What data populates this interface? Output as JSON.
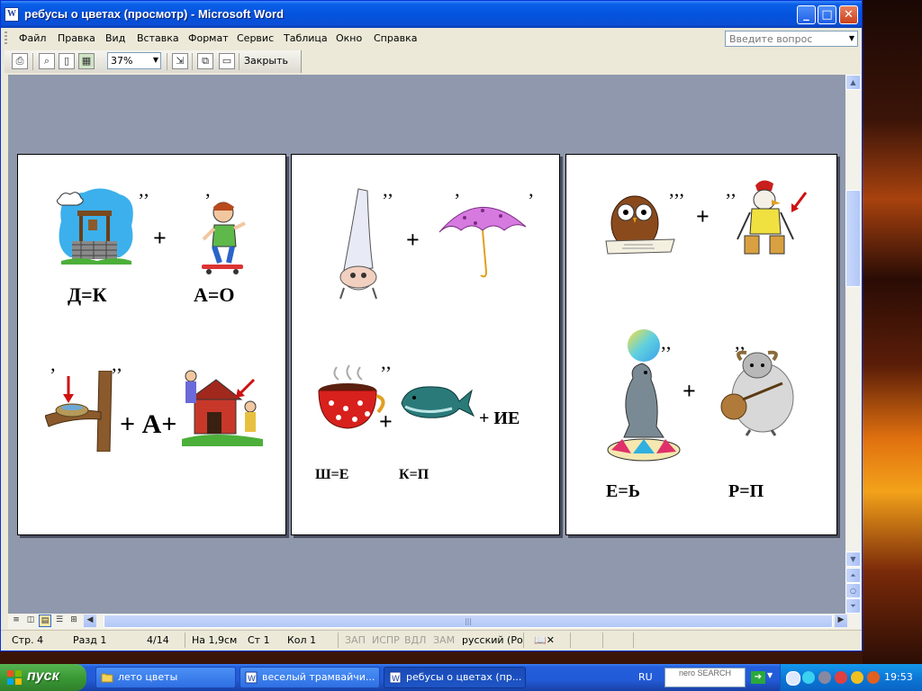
{
  "window": {
    "title": "ребусы о цветах (просмотр) - Microsoft Word",
    "app_icon_glyph": "W",
    "buttons": {
      "minimize": "_",
      "maximize": "□",
      "close": "✕"
    }
  },
  "menu": {
    "items": [
      "Файл",
      "Правка",
      "Вид",
      "Вставка",
      "Формат",
      "Сервис",
      "Таблица",
      "Окно",
      "Справка"
    ],
    "help_placeholder": "Введите вопрос"
  },
  "toolbar": {
    "zoom": "37%",
    "close_label": "Закрыть",
    "icons": [
      "print-icon",
      "magnifier-icon",
      "one-page-icon",
      "multiple-pages-icon",
      "shrink-to-fit-icon",
      "full-screen-icon",
      "close-preview-icon"
    ]
  },
  "pages": {
    "page1": {
      "caption_a": "Д=К",
      "caption_b": "А=О",
      "plus_1": "+",
      "plus_2": "+ А+",
      "comma_double": "’’",
      "comma_single": "’"
    },
    "page2": {
      "plus_1": "+",
      "plus_2": "+",
      "tail": "+ ИЕ",
      "caption_a": "Ш=Е",
      "caption_b": "К=П",
      "comma_double": "’’",
      "comma_single": "’"
    },
    "page3": {
      "plus_1": "+",
      "plus_2": "+",
      "caption_a": "Е=Ь",
      "caption_b": "Р=П",
      "comma_triple": "’’’",
      "comma_double": "’’",
      "comma_single": "’"
    }
  },
  "status": {
    "page": "Стр. 4",
    "section": "Разд 1",
    "pages": "4/14",
    "at": "На 1,9см",
    "line": "Ст 1",
    "col": "Кол 1",
    "rec": "ЗАП",
    "trk": "ИСПР",
    "ext": "ВДЛ",
    "ovr": "ЗАМ",
    "language": "русский (Ро"
  },
  "taskbar": {
    "start": "пуск",
    "tasks": [
      {
        "label": "лето цветы",
        "icon": "folder-icon"
      },
      {
        "label": "веселый трамвайчи...",
        "icon": "word-doc-icon"
      },
      {
        "label": "ребусы о цветах (пр...",
        "icon": "word-doc-icon"
      }
    ],
    "language": "RU",
    "nero": "nero SEARCH",
    "clock": "19:53"
  },
  "colors": {
    "titlebar": "#0453dd",
    "doc_background": "#8f98ac",
    "taskbar": "#245edb",
    "start_button": "#3a9a35"
  }
}
